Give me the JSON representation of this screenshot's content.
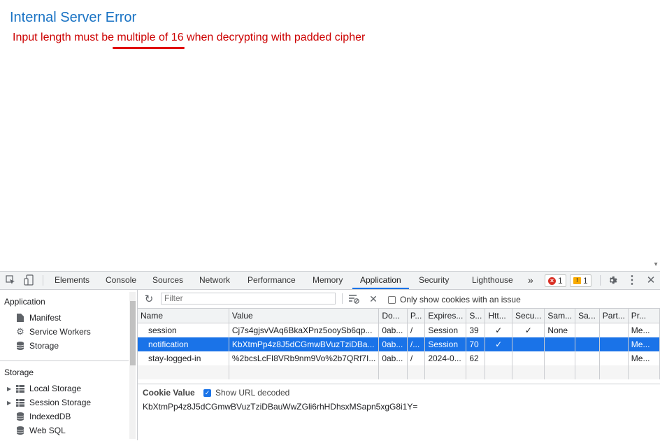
{
  "page": {
    "error_title": "Internal Server Error",
    "error_message": "Input length must be multiple of 16 when decrypting with padded cipher"
  },
  "devtools": {
    "tabs": [
      "Elements",
      "Console",
      "Sources",
      "Network",
      "Performance",
      "Memory",
      "Application",
      "Security",
      "Lighthouse"
    ],
    "active_tab": "Application",
    "more_tabs_glyph": "»",
    "error_count": "1",
    "warning_count": "1",
    "sidebar": {
      "application_header": "Application",
      "application_items": [
        "Manifest",
        "Service Workers",
        "Storage"
      ],
      "storage_header": "Storage",
      "storage_items": [
        "Local Storage",
        "Session Storage",
        "IndexedDB",
        "Web SQL"
      ]
    },
    "toolbar": {
      "filter_placeholder": "Filter",
      "only_issues_label": "Only show cookies with an issue",
      "only_issues_checked": false
    },
    "table": {
      "columns": [
        "Name",
        "Value",
        "Do...",
        "P...",
        "Expires...",
        "S...",
        "Htt...",
        "Secu...",
        "Sam...",
        "Sa...",
        "Part...",
        "Pr..."
      ],
      "rows": [
        {
          "name": "session",
          "value": "Cj7s4gjsvVAq6BkaXPnz5ooySb6qp...",
          "domain": "0ab...",
          "path": "/",
          "expires": "Session",
          "size": "39",
          "httponly": "✓",
          "secure": "✓",
          "samesite": "None",
          "sameparty": "",
          "partition": "",
          "priority": "Me..."
        },
        {
          "name": "notification",
          "value": "KbXtmPp4z8J5dCGmwBVuzTziDBa...",
          "domain": "0ab...",
          "path": "/...",
          "expires": "Session",
          "size": "70",
          "httponly": "✓",
          "secure": "",
          "samesite": "",
          "sameparty": "",
          "partition": "",
          "priority": "Me...",
          "selected": true
        },
        {
          "name": "stay-logged-in",
          "value": "%2bcsLcFI8VRb9nm9Vo%2b7QRf7I...",
          "domain": "0ab...",
          "path": "/",
          "expires": "2024-0...",
          "size": "62",
          "httponly": "",
          "secure": "",
          "samesite": "",
          "sameparty": "",
          "partition": "",
          "priority": "Me..."
        }
      ]
    },
    "cookie_value": {
      "label": "Cookie Value",
      "show_decoded_label": "Show URL decoded",
      "show_decoded_checked": true,
      "value": "KbXtmPp4z8J5dCGmwBVuzTziDBauWwZGli6rhHDhsxMSapn5xgG8i1Y="
    }
  },
  "colors": {
    "accent": "#1a73e8",
    "error_title": "#1a73c4",
    "error_text": "#cc0000",
    "underline": "#e00000"
  }
}
